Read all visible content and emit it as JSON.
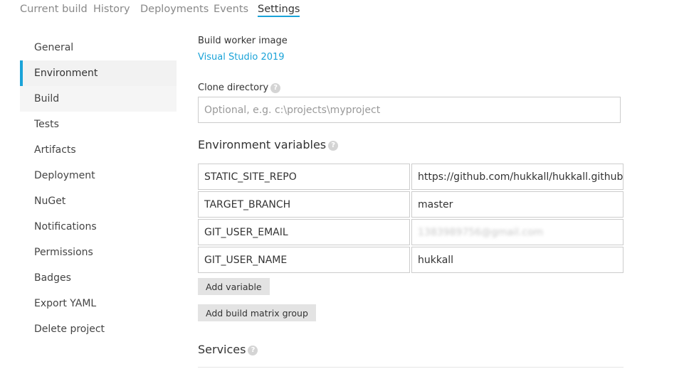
{
  "tabs": [
    "Current build",
    "History",
    "Deployments",
    "Events",
    "Settings"
  ],
  "sidebar": {
    "items": [
      "General",
      "Environment",
      "Build",
      "Tests",
      "Artifacts",
      "Deployment",
      "NuGet",
      "Notifications",
      "Permissions",
      "Badges",
      "Export YAML",
      "Delete project"
    ]
  },
  "build_worker": {
    "label": "Build worker image",
    "value": "Visual Studio 2019"
  },
  "clone_dir": {
    "label": "Clone directory",
    "placeholder": "Optional, e.g. c:\\projects\\myproject"
  },
  "env": {
    "heading": "Environment variables",
    "vars": [
      {
        "name": "STATIC_SITE_REPO",
        "value": "https://github.com/hukkall/hukkall.github."
      },
      {
        "name": "TARGET_BRANCH",
        "value": "master"
      },
      {
        "name": "GIT_USER_EMAIL",
        "value": "1383989756@gmail.com"
      },
      {
        "name": "GIT_USER_NAME",
        "value": "hukkall"
      }
    ],
    "add_variable": "Add variable",
    "add_matrix": "Add build matrix group"
  },
  "services": {
    "heading": "Services"
  },
  "help_glyph": "?",
  "colors": {
    "accent": "#1aa3d8"
  }
}
